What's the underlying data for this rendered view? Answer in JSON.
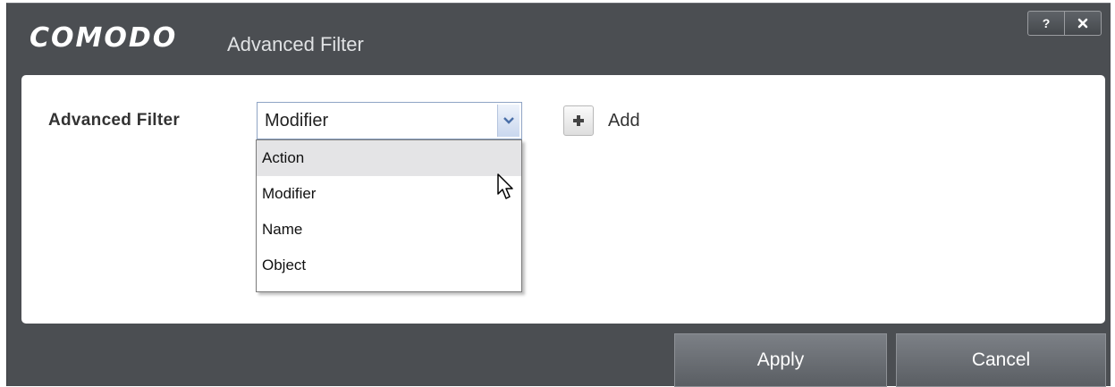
{
  "window": {
    "brand": "COMODO",
    "title": "Advanced Filter",
    "help_label": "?",
    "close_label": "close"
  },
  "filter": {
    "label": "Advanced Filter",
    "selected": "Modifier",
    "options": [
      "Action",
      "Modifier",
      "Name",
      "Object"
    ],
    "hovered_option": "Action"
  },
  "add": {
    "icon": "plus-icon",
    "label": "Add"
  },
  "footer": {
    "apply_label": "Apply",
    "cancel_label": "Cancel"
  },
  "colors": {
    "chrome": "#4b4e52",
    "panel": "#ffffff",
    "button": "#6b6f74",
    "hover": "#e4e4e6"
  }
}
